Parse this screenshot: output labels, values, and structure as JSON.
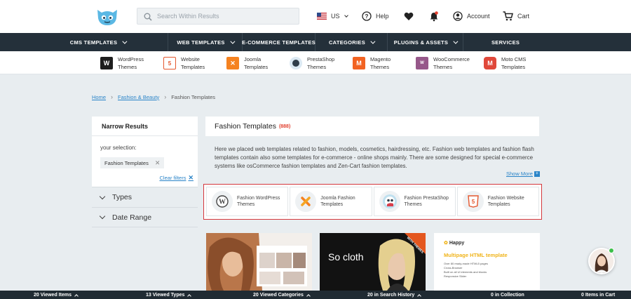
{
  "header": {
    "search_placeholder": "Search Within Results",
    "locale": "US",
    "help": "Help",
    "account": "Account",
    "cart": "Cart"
  },
  "main_nav": [
    "CMS TEMPLATES",
    "WEB TEMPLATES",
    "E-COMMERCE TEMPLATES",
    "CATEGORIES",
    "PLUGINS & ASSETS",
    "SERVICES"
  ],
  "sub_nav": [
    {
      "line1": "WordPress",
      "line2": "Themes",
      "icon": "wordpress-icon",
      "color": "#1e1e1e"
    },
    {
      "line1": "Website",
      "line2": "Templates",
      "icon": "html5-icon",
      "color": "#e4572e"
    },
    {
      "line1": "Joomla",
      "line2": "Templates",
      "icon": "joomla-icon",
      "color": "#f58220"
    },
    {
      "line1": "PrestaShop",
      "line2": "Themes",
      "icon": "prestashop-icon",
      "color": "#2f6f9f"
    },
    {
      "line1": "Magento",
      "line2": "Themes",
      "icon": "magento-icon",
      "color": "#f26322"
    },
    {
      "line1": "WooCommerce",
      "line2": "Themes",
      "icon": "woocommerce-icon",
      "color": "#96588a"
    },
    {
      "line1": "Moto CMS",
      "line2": "Templates",
      "icon": "motocms-icon",
      "color": "#e0483a"
    }
  ],
  "breadcrumb": [
    "Home",
    "Fashion & Beauty",
    "Fashion Templates"
  ],
  "sidebar": {
    "title": "Narrow Results",
    "your_selection": "your selection:",
    "chip": "Fashion Templates",
    "clear": "Clear filters",
    "facets": [
      "Types",
      "Date Range"
    ]
  },
  "main": {
    "title": "Fashion Templates",
    "count": "(888)",
    "description": "Here we placed web templates related to fashion, models, cosmetics, hairdressing, etc. Fashion web templates and fashion flash templates contain also some templates for e-commerce - online shops mainly. There are some designed for special e-commerce systems like osCommerce fashion templates and Zen-Cart fashion templates.",
    "show_more": "Show More",
    "categories": [
      {
        "line1": "Fashion WordPress",
        "line2": "Themes",
        "icon": "wordpress-icon"
      },
      {
        "line1": "Joomla Fashion",
        "line2": "Templates",
        "icon": "joomla-icon"
      },
      {
        "line1": "Fashion PrestaShop",
        "line2": "Themes",
        "icon": "prestashop-icon"
      },
      {
        "line1": "Fashion Website",
        "line2": "Templates",
        "icon": "html5-icon"
      }
    ]
  },
  "cards": {
    "card2_text": "So cloth",
    "card2_badge": "WITH THEMES",
    "card3_brand": "Happy",
    "card3_title": "Multipage HTML template",
    "card3_bullets": [
      "Over 80 ready-made HTML5 pages",
      "Cross-Browser",
      "Built on all UI elements and blocks",
      "Responsive Slider"
    ]
  },
  "footer": {
    "viewed_items": "20 Viewed Items",
    "viewed_types": "13 Viewed Types",
    "viewed_categories": "20 Viewed Categories",
    "search_history": "20 in Search History",
    "collection": "0 in Collection",
    "cart_items": "0 Items in Cart"
  }
}
